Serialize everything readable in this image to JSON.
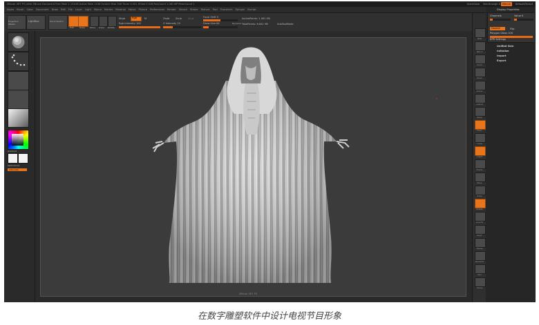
{
  "titlebar": {
    "text": "ZBrush 4R7 P3 (x64)  ZBrush Document   Free Mem 1.131GB  Active Mem 1036  Scratch Disk 306  Timer 0.001  ATime 0.016  PolyCount 1.061 MP  MeshCount 1",
    "quicksave": "QuickSave",
    "seethrough": "See-through 0",
    "menus_btn": "Menus",
    "script": "DefaultZScript"
  },
  "menubar": [
    "Alpha",
    "Brush",
    "Color",
    "Document",
    "Draw",
    "Edit",
    "File",
    "Layer",
    "Light",
    "Macro",
    "Marker",
    "Material",
    "Movie",
    "Picture",
    "Preferences",
    "Render",
    "Stencil",
    "Stroke",
    "Texture",
    "Tool",
    "Transform",
    "Zplugin",
    "Zscript"
  ],
  "toolbar": {
    "projection_master": "Projection Master",
    "lightbox": "LightBox",
    "quick_sketch": "Quick Sketch",
    "edit": "Edit",
    "draw": "Draw",
    "move": "Move",
    "scale": "Scale",
    "rotate": "Rotate",
    "mrgb": "Mrgb",
    "rgb": "Rgb",
    "m": "M",
    "zadd": "Zadd",
    "zsub": "Zsub",
    "zcut": "Zcut",
    "rgb_intensity": "Rgb Intensity 100",
    "z_intensity": "Z Intensity 25",
    "focal_shift": "Focal Shift 0",
    "draw_size": "Draw Size 64",
    "dynamic": "Dynamic",
    "active_points": "ActivePoints: 1.061 Mil",
    "total_points": "TotalPoints: 6.641 Mil",
    "subtool_mode": "SubToolMode"
  },
  "left_tray": {
    "gradient_label": "Gradient",
    "switch_color": "SwitchColor",
    "alternate": "Alternate"
  },
  "right_shelf": {
    "labels": [
      "BPR",
      "SPix 3",
      "Scroll",
      "Zoom",
      "Actual",
      "AAHalf",
      "Persp",
      "Floor",
      "Local",
      "L.Sym",
      "Frame",
      "Move",
      "Scale",
      "Rotate",
      "Line Fill",
      "PolyF",
      "Transp",
      "Dynamic",
      "Solo",
      "Xpose"
    ]
  },
  "right_tray": {
    "title": "Display Properties",
    "channels": "Channels",
    "value": "Value 0",
    "double": "Double",
    "flip": "Flip",
    "polygon_gloss": "Polygon Gloss 100",
    "bpr_settings": "BPR Settings",
    "menu": [
      "Unified Skin",
      "Initialize",
      "Import",
      "Export"
    ]
  },
  "viewport": {
    "model": "Hooded cloaked figure sculpt",
    "footer": "ZBrush 4R7 P3"
  },
  "caption": "在数字雕塑软件中设计电视节目形象",
  "colors": {
    "accent": "#e8751c",
    "panel": "#2f2f2f",
    "viewport_bg": "#3b3b3b",
    "model": "#d8d8d8"
  }
}
